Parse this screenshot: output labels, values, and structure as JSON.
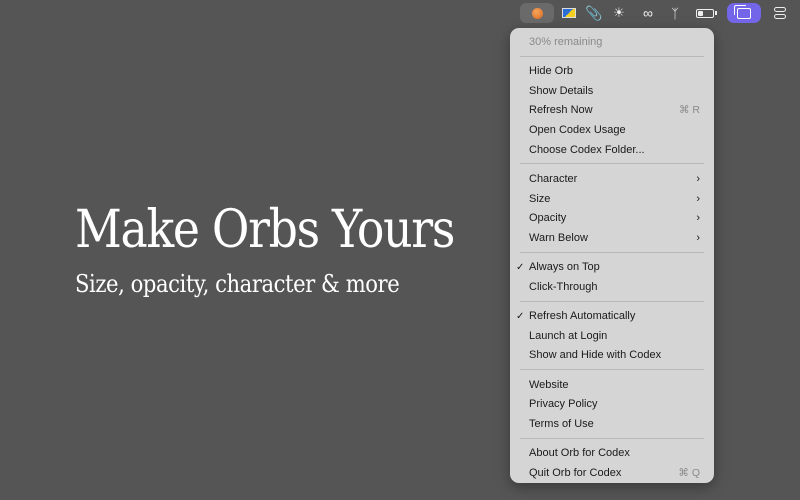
{
  "menubar": {
    "items": [
      "orb-status",
      "input-source",
      "paperclip",
      "brightness",
      "link",
      "bluetooth",
      "battery",
      "windows",
      "control-center"
    ]
  },
  "hero": {
    "title": "Make Orbs Yours",
    "subtitle": "Size, opacity, character & more"
  },
  "menu": {
    "status": "30% remaining",
    "hide_orb": "Hide Orb",
    "show_details": "Show Details",
    "refresh_now": "Refresh Now",
    "refresh_now_shortcut": "⌘ R",
    "open_usage": "Open Codex Usage",
    "choose_folder": "Choose Codex Folder...",
    "character": "Character",
    "size": "Size",
    "opacity": "Opacity",
    "warn_below": "Warn Below",
    "always_on_top": "Always on Top",
    "click_through": "Click-Through",
    "refresh_auto": "Refresh Automatically",
    "launch_login": "Launch at Login",
    "show_hide_codex": "Show and Hide with Codex",
    "website": "Website",
    "privacy": "Privacy Policy",
    "terms": "Terms of Use",
    "about": "About Orb for Codex",
    "quit": "Quit Orb for Codex",
    "quit_shortcut": "⌘ Q",
    "checkmark": "✓",
    "chevron": "›"
  }
}
